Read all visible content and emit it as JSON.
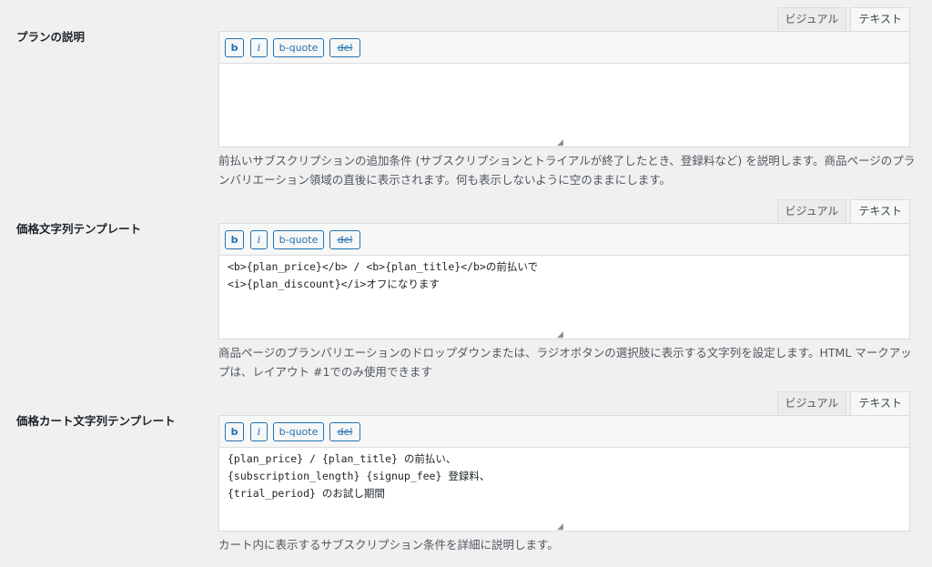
{
  "fields": [
    {
      "label": "プランの説明",
      "tabs": {
        "visual": "ビジュアル",
        "text": "テキスト"
      },
      "toolbar": {
        "b": "b",
        "i": "i",
        "bquote": "b-quote",
        "del": "del"
      },
      "content": "",
      "description": "前払いサブスクリプションの追加条件 (サブスクリプションとトライアルが終了したとき、登録料など) を説明します。商品ページのプランバリエーション領域の直後に表示されます。何も表示しないように空のままにします。"
    },
    {
      "label": "価格文字列テンプレート",
      "tabs": {
        "visual": "ビジュアル",
        "text": "テキスト"
      },
      "toolbar": {
        "b": "b",
        "i": "i",
        "bquote": "b-quote",
        "del": "del"
      },
      "content": "<b>{plan_price}</b> / <b>{plan_title}</b>の前払いで\n<i>{plan_discount}</i>オフになります",
      "description": "商品ページのプランバリエーションのドロップダウンまたは、ラジオボタンの選択肢に表示する文字列を設定します。HTML マークアップは、レイアウト #1でのみ使用できます"
    },
    {
      "label": "価格カート文字列テンプレート",
      "tabs": {
        "visual": "ビジュアル",
        "text": "テキスト"
      },
      "toolbar": {
        "b": "b",
        "i": "i",
        "bquote": "b-quote",
        "del": "del"
      },
      "content": "{plan_price} / {plan_title} の前払い、\n{subscription_length} {signup_fee} 登録料、\n{trial_period} のお試し期間",
      "description": "カート内に表示するサブスクリプション条件を詳細に説明します。"
    }
  ],
  "colors": {
    "accent": "#2271b1",
    "background": "#f0f0f1"
  }
}
